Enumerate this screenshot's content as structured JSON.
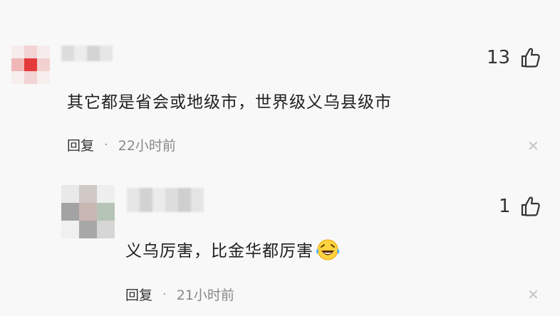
{
  "comments": [
    {
      "text": "其它都是省会或地级市，世界级义乌县级市",
      "likes": "13",
      "reply_label": "回复",
      "separator": "·",
      "time": "22小时前"
    },
    {
      "text": "义乌厉害，比金华都厉害",
      "emoji": "laughing-tears-emoji",
      "likes": "1",
      "reply_label": "回复",
      "separator": "·",
      "time": "21小时前"
    }
  ],
  "icons": {
    "like": "thumbs-up-icon",
    "close": "close-icon"
  },
  "avatar_colors": {
    "first": [
      "#f7ecec",
      "#f3d3d3",
      "#f7ecec",
      "#f0b7b7",
      "#e53a3a",
      "#f3d0d0",
      "#f7eeee",
      "#f2d4d4",
      "#f7eeee"
    ],
    "second": [
      "#e9e9e9",
      "#d0c9c6",
      "#eeeeee",
      "#a3a3a3",
      "#c9b7b3",
      "#b6c4b5",
      "#f0f0f0",
      "#a7a7a7",
      "#d6d6d6"
    ]
  }
}
